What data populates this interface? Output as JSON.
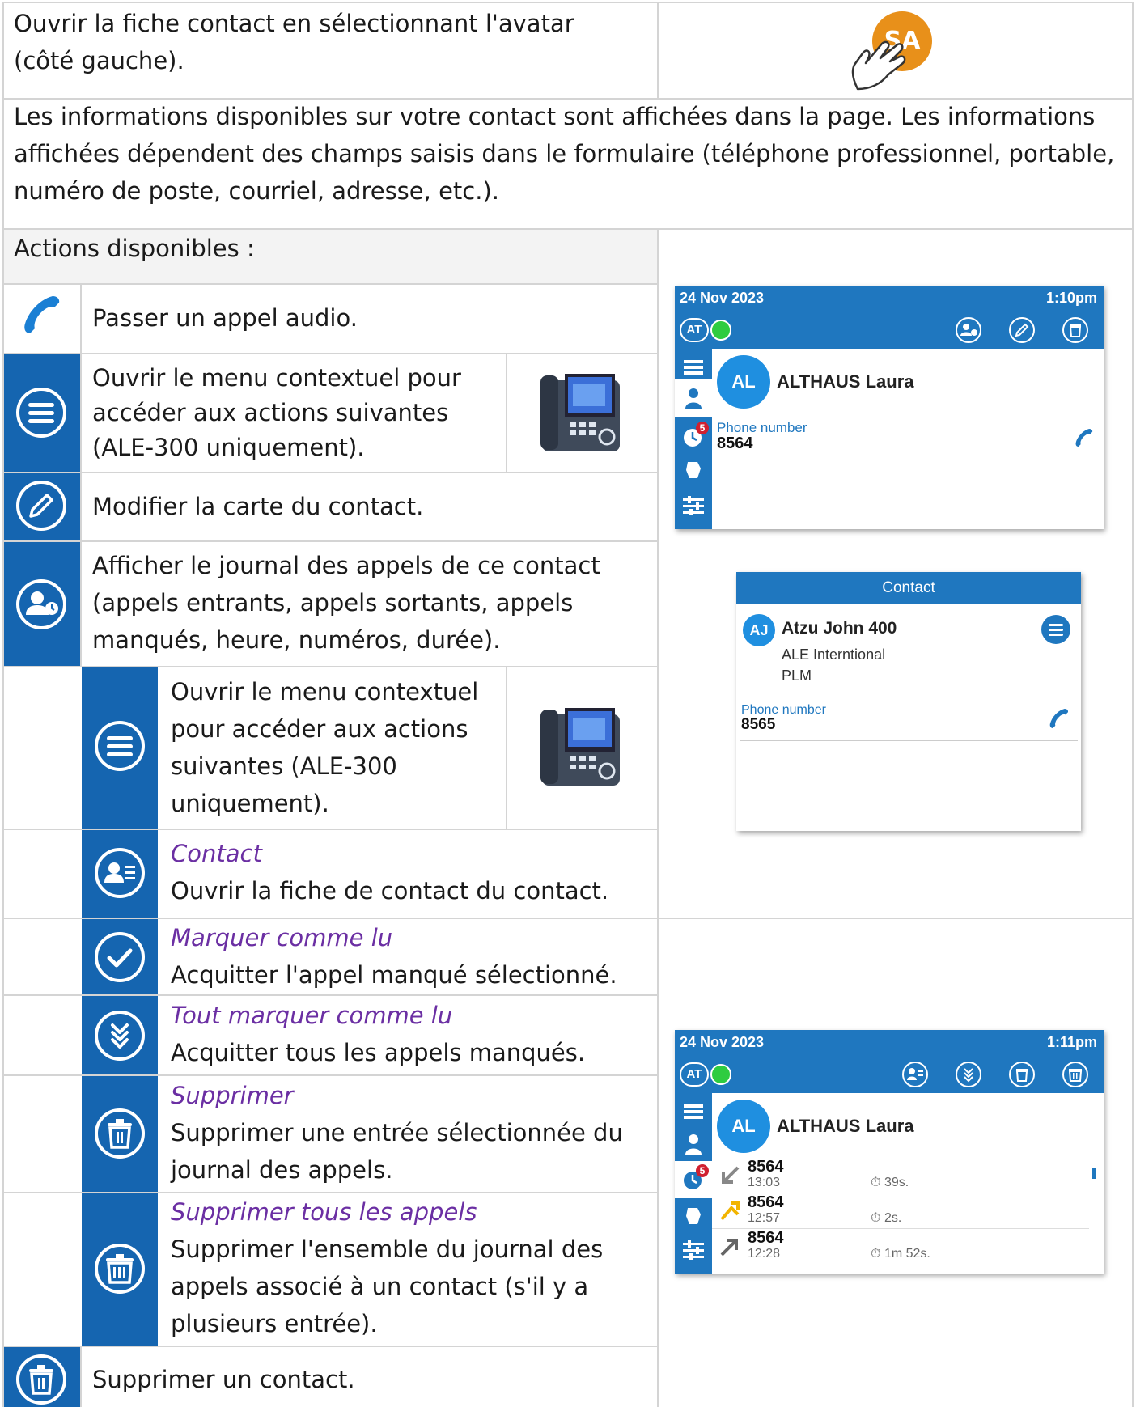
{
  "intro": {
    "text": "Ouvrir la fiche contact en sélectionnant l'avatar (côté gauche).",
    "avatar_initials": "SA"
  },
  "description": "Les informations disponibles sur votre contact sont affichées dans la page. Les informations affichées dépendent des champs saisis dans le formulaire (téléphone professionnel, portable, numéro de poste, courriel, adresse, etc.).",
  "actions_header": "Actions disponibles :",
  "actions": {
    "call": "Passer un appel audio.",
    "menu": "Ouvrir le menu contextuel pour accéder aux actions suivantes (ALE-300 uniquement).",
    "edit": "Modifier la carte du contact.",
    "journal": "Afficher le journal des appels de ce contact (appels entrants, appels sortants, appels manqués, heure, numéros, durée).",
    "sub_menu": "Ouvrir le menu contextuel pour accéder aux actions suivantes (ALE-300 uniquement).",
    "contact_title": "Contact",
    "contact_desc": "Ouvrir la fiche de contact du contact.",
    "mark_read_title": "Marquer comme lu",
    "mark_read_desc": "Acquitter l'appel manqué sélectionné.",
    "mark_all_title": "Tout marquer comme lu",
    "mark_all_desc": "Acquitter tous les appels manqués.",
    "delete_title": "Supprimer",
    "delete_desc": "Supprimer une entrée sélectionnée du journal des appels.",
    "delete_all_title": "Supprimer tous les appels",
    "delete_all_desc": "Supprimer l'ensemble du journal des appels associé à un contact (s'il y a plusieurs entrée).",
    "delete_contact": "Supprimer un contact."
  },
  "phone1": {
    "date": "24 Nov 2023",
    "time": "1:10pm",
    "presence": "AT",
    "avatar": "AL",
    "name": "ALTHAUS Laura",
    "phone_label": "Phone number",
    "phone_number": "8564",
    "badge": "5"
  },
  "phone2": {
    "header": "Contact",
    "avatar": "AJ",
    "name": "Atzu John 400",
    "company": "ALE Interntional",
    "dept": "PLM",
    "phone_label": "Phone number",
    "phone_number": "8565"
  },
  "phone3": {
    "date": "24 Nov 2023",
    "time": "1:11pm",
    "presence": "AT",
    "avatar": "AL",
    "name": "ALTHAUS Laura",
    "badge": "5",
    "calls": [
      {
        "number": "8564",
        "time": "13:03",
        "duration": "39s."
      },
      {
        "number": "8564",
        "time": "12:57",
        "duration": "2s."
      },
      {
        "number": "8564",
        "time": "12:28",
        "duration": "1m 52s."
      }
    ]
  },
  "colors": {
    "accent": "#1565b0",
    "phone_header": "#1f77bf",
    "avatar_orange": "#e8901a",
    "italic_title": "#6b2fa3"
  }
}
